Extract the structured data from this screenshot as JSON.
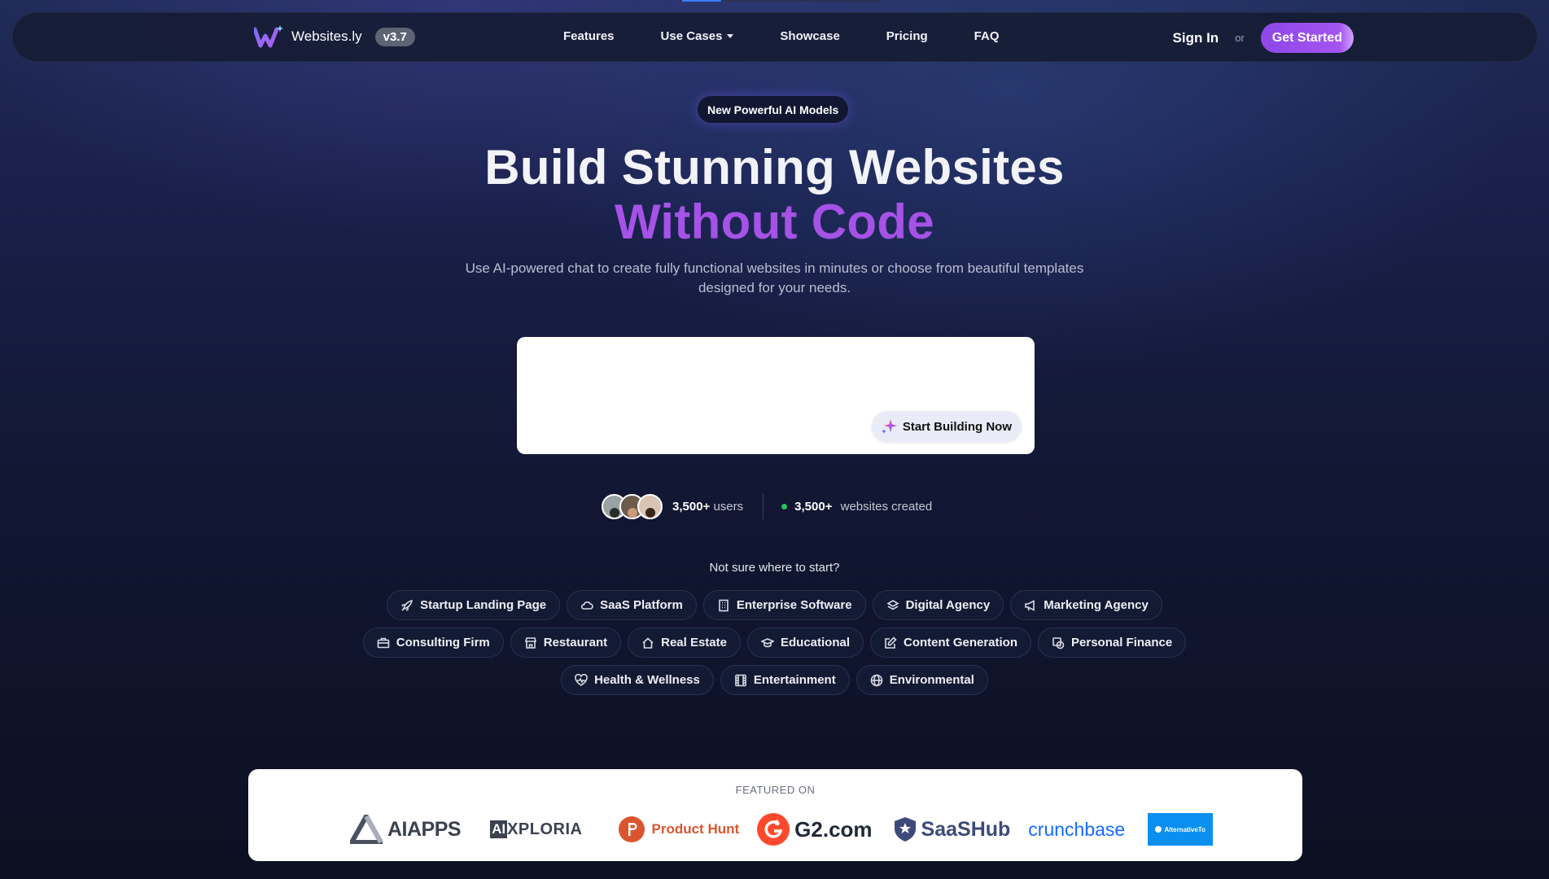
{
  "brand": {
    "name": "Websites.ly",
    "version": "v3.7"
  },
  "nav": {
    "links": [
      "Features",
      "Use Cases",
      "Showcase",
      "Pricing",
      "FAQ"
    ],
    "sign_in": "Sign In",
    "or": "or",
    "get_started": "Get Started"
  },
  "hero": {
    "badge": "New Powerful AI Models",
    "title_line1": "Build Stunning Websites",
    "title_line2": "Without Code",
    "subtitle": "Use AI-powered chat to create fully functional websites in minutes or choose from beautiful templates designed for your needs."
  },
  "prompt": {
    "placeholder": "",
    "button": "Start Building Now"
  },
  "stats": {
    "users_count": "3,500+",
    "users_label": "users",
    "websites_count": "3,500+",
    "websites_label": "websites created"
  },
  "suggestions": {
    "title": "Not sure where to start?",
    "row1": [
      {
        "label": "Startup Landing Page",
        "icon": "rocket-icon"
      },
      {
        "label": "SaaS Platform",
        "icon": "cloud-icon"
      },
      {
        "label": "Enterprise Software",
        "icon": "building-icon"
      },
      {
        "label": "Digital Agency",
        "icon": "layers-icon"
      },
      {
        "label": "Marketing Agency",
        "icon": "megaphone-icon"
      }
    ],
    "row2": [
      {
        "label": "Consulting Firm",
        "icon": "briefcase-icon"
      },
      {
        "label": "Restaurant",
        "icon": "store-icon"
      },
      {
        "label": "Real Estate",
        "icon": "home-icon"
      },
      {
        "label": "Educational",
        "icon": "graduation-cap-icon"
      },
      {
        "label": "Content Generation",
        "icon": "edit-icon"
      },
      {
        "label": "Personal Finance",
        "icon": "piggy-bank-icon"
      }
    ],
    "row3": [
      {
        "label": "Health & Wellness",
        "icon": "heart-pulse-icon"
      },
      {
        "label": "Entertainment",
        "icon": "film-icon"
      },
      {
        "label": "Environmental",
        "icon": "globe-icon"
      }
    ]
  },
  "featured": {
    "title": "FEATURED ON",
    "logos": [
      "AIAPPS",
      "XPLORIA",
      "Product Hunt",
      "G2.com",
      "SaaSHub",
      "crunchbase",
      "AlternativeTo"
    ],
    "logo_prefix_ai": "AI"
  },
  "colors": {
    "accent": "#a552e6",
    "button_gradient_start": "#8f47e8",
    "product_hunt": "#da552f",
    "g2": "#ff492c",
    "saashub": "#3d4a7a",
    "crunchbase": "#146aff",
    "alternativeto": "#0a8ff0",
    "green_dot": "#22c55e"
  }
}
